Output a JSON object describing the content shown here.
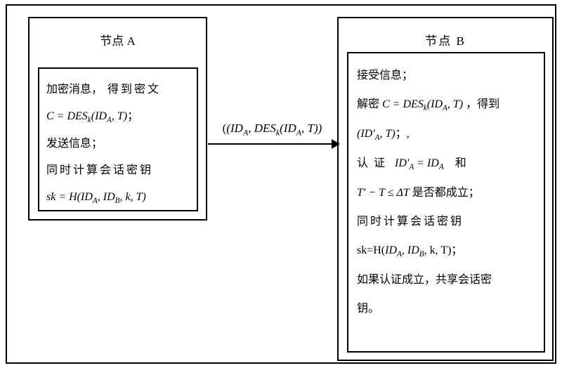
{
  "nodeA": {
    "title": "节点 A",
    "line1_a": "加密消息，",
    "line1_b": " 得到密文",
    "line2": "C = DES",
    "line2_sub": "k",
    "line2_post": "(ID",
    "line2_sub2": "A",
    "line2_post2": ", T)",
    "line2_end": "；",
    "line3": "发送信息；",
    "line4": "同时计算会话密钥",
    "line5": "sk = H(ID",
    "line5_sub1": "A",
    "line5_mid": ", ID",
    "line5_sub2": "B",
    "line5_post": ", k, T)"
  },
  "arrow": {
    "label": "(ID",
    "label_sub1": "A",
    "label_mid": ", DES",
    "label_sub2": "k",
    "label_mid2": "(ID",
    "label_sub3": "A",
    "label_end": ", T))"
  },
  "nodeB": {
    "title": "节点  B",
    "line1": "接受信息；",
    "line2a": "解密 ",
    "line2b": "C = DES",
    "line2b_sub": "k",
    "line2b_post": "(ID",
    "line2b_sub2": "A",
    "line2b_post2": ", T)",
    "line2c": " ，得到",
    "line3": " (ID'",
    "line3_sub": "A",
    "line3_end": ", T)",
    "line3_cjk": "；,",
    "line4a": "认 证",
    "line4b": "ID'",
    "line4b_sub": "A",
    "line4b_mid": " = ID",
    "line4b_sub2": "A",
    "line4c": "和",
    "line5a": "T' − T ≤ ΔT",
    "line5b": " 是否都成立；",
    "line6": "同时计算会话密钥",
    "line7a": "sk=H(",
    "line7b": "ID",
    "line7b_sub": "A",
    "line7b_mid": ", ID",
    "line7b_sub2": "B",
    "line7b_end": ",",
    "line7c": "  k, T)；",
    "line8": "如果认证成立，共享会话密",
    "line9": "钥。"
  }
}
